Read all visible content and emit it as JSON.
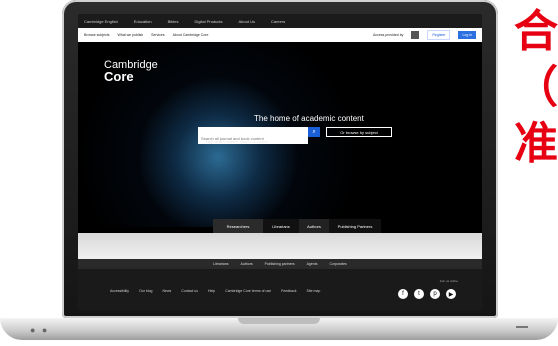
{
  "top_nav": {
    "items": [
      "Cambridge English",
      "Education",
      "Bibles",
      "Digital Products",
      "About Us",
      "Careers"
    ]
  },
  "sub_nav": {
    "items": [
      "Browse subjects",
      "What we publish",
      "Services",
      "About Cambridge Core"
    ],
    "search_label": "Access provided by",
    "register": "Register",
    "login": "Log in"
  },
  "logo": {
    "line1": "Cambridge",
    "line2": "Core"
  },
  "hero": {
    "title": "The home of academic content",
    "search_placeholder": "Search all journal and book content",
    "browse_button": "Or browse by subject",
    "help": "Help search content / Search all content"
  },
  "tabs": [
    "Researchers",
    "Librarians",
    "Authors",
    "Publishing Partners"
  ],
  "footer_links": [
    "Librarians",
    "Authors",
    "Publishing partners",
    "Agents",
    "Corporates"
  ],
  "footer_bottom": [
    "Accessibility",
    "Our blog",
    "News",
    "Contact us",
    "Help",
    "Cambridge Core terms of use",
    "Feedback",
    "Site map"
  ],
  "follow_label": "Join us online",
  "social_icons": [
    "facebook-icon",
    "twitter-icon",
    "pinterest-icon",
    "youtube-icon"
  ],
  "red_text": {
    "line1": "合",
    "line2": "（(",
    "line3": "准"
  }
}
